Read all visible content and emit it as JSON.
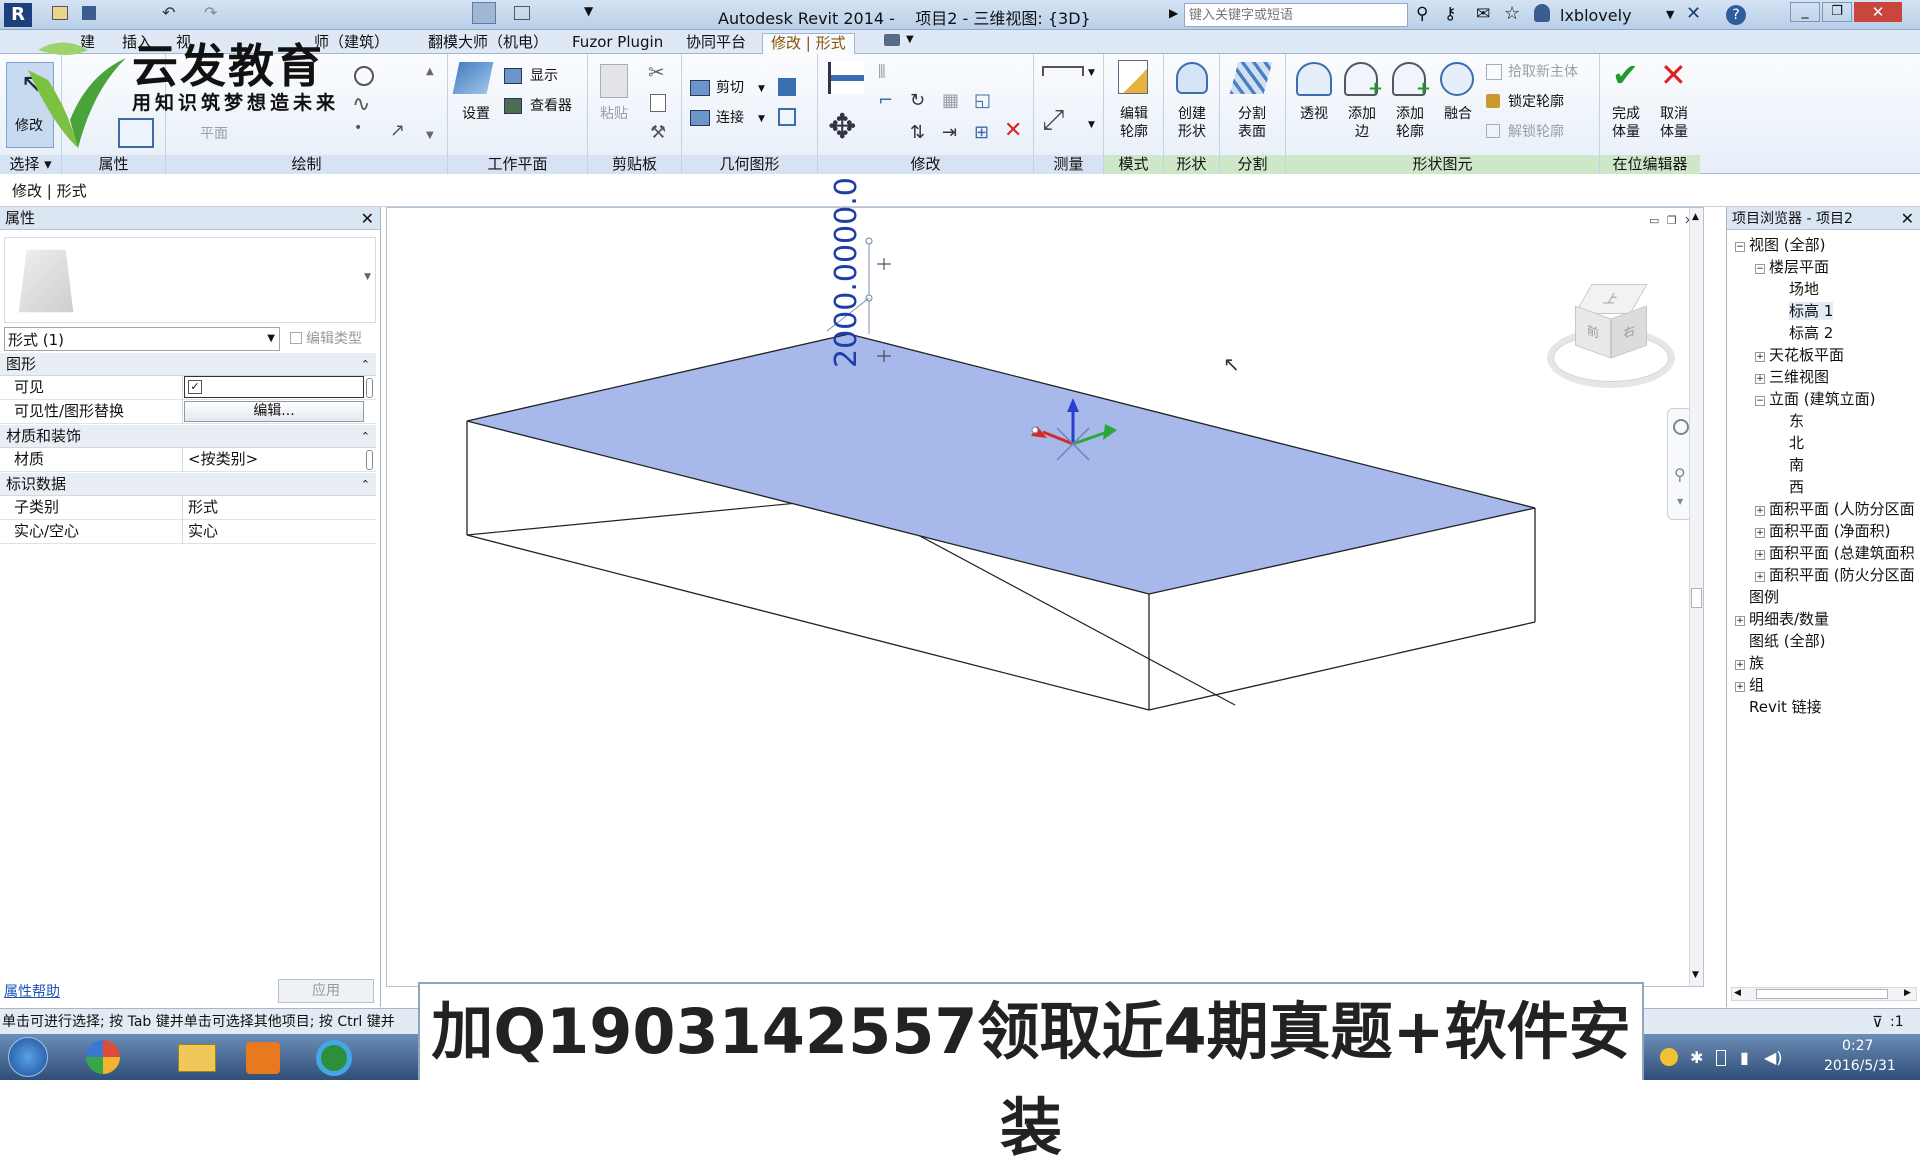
{
  "titlebar": {
    "title": "Autodesk Revit 2014 -    项目2 - 三维视图: {3D}",
    "search_placeholder": "键入关键字或短语",
    "user": "lxblovely"
  },
  "logo": {
    "brand": "云发教育",
    "slogan": "用知识筑梦想造未来"
  },
  "tabs": [
    {
      "label": "建"
    },
    {
      "label": "插入"
    },
    {
      "label": "视"
    },
    {
      "label": "师（建筑）"
    },
    {
      "label": "翻模大师（机电）"
    },
    {
      "label": "Fuzor Plugin"
    },
    {
      "label": "协同平台"
    },
    {
      "label": "修改 | 形式"
    }
  ],
  "ribbon": {
    "groups": {
      "select": "选择 ▾",
      "properties": "属性",
      "draw": "绘制",
      "workplane": "工作平面",
      "clipboard": "剪贴板",
      "geometry": "几何图形",
      "modify": "修改",
      "measure": "测量",
      "mode": "模式",
      "shape": "形状",
      "divide": "分割",
      "form_element": "形状图元",
      "inplace_editor": "在位编辑器"
    },
    "buttons": {
      "modify": "修改",
      "plane": "平面",
      "set": "设置",
      "show": "显示",
      "viewer": "查看器",
      "paste": "粘贴",
      "cut": "剪切",
      "join": "连接",
      "edit_profile_1": "编辑",
      "edit_profile_2": "轮廓",
      "create_form_1": "创建",
      "create_form_2": "形状",
      "divide_surface_1": "分割",
      "divide_surface_2": "表面",
      "xray": "透视",
      "add_edge_1": "添加",
      "add_edge_2": "边",
      "add_profile_1": "添加",
      "add_profile_2": "轮廓",
      "blend": "融合",
      "pick_host": "拾取新主体",
      "lock_profile": "锁定轮廓",
      "unlock_profile": "解锁轮廓",
      "finish_1": "完成",
      "finish_2": "体量",
      "cancel_1": "取消",
      "cancel_2": "体量"
    }
  },
  "context_bar": "修改 | 形式",
  "properties": {
    "title": "属性",
    "type_selector": "形式 (1)",
    "edit_type": "编辑类型",
    "sections": {
      "graphics": "图形",
      "materials": "材质和装饰",
      "identity": "标识数据"
    },
    "rows": {
      "visible_label": "可见",
      "visibility_override_label": "可见性/图形替换",
      "visibility_override_button": "编辑...",
      "material_label": "材质",
      "material_value": "<按类别>",
      "subcategory_label": "子类别",
      "subcategory_value": "形式",
      "solid_void_label": "实心/空心",
      "solid_void_value": "实心"
    },
    "help_link": "属性帮助",
    "apply_button": "应用"
  },
  "viewport": {
    "dimension_label": "2000.0000.0",
    "viewcube_labels": {
      "top": "上",
      "front": "前",
      "right": "右"
    }
  },
  "project_browser": {
    "title": "项目浏览器 - 项目2",
    "items": [
      {
        "label": "视图 (全部)",
        "level": 0,
        "toggle": "−"
      },
      {
        "label": "楼层平面",
        "level": 1,
        "toggle": "−"
      },
      {
        "label": "场地",
        "level": 2,
        "toggle": ""
      },
      {
        "label": "标高 1",
        "level": 2,
        "toggle": ""
      },
      {
        "label": "标高 2",
        "level": 2,
        "toggle": ""
      },
      {
        "label": "天花板平面",
        "level": 1,
        "toggle": "+"
      },
      {
        "label": "三维视图",
        "level": 1,
        "toggle": "+"
      },
      {
        "label": "立面 (建筑立面)",
        "level": 1,
        "toggle": "−"
      },
      {
        "label": "东",
        "level": 2,
        "toggle": ""
      },
      {
        "label": "北",
        "level": 2,
        "toggle": ""
      },
      {
        "label": "南",
        "level": 2,
        "toggle": ""
      },
      {
        "label": "西",
        "level": 2,
        "toggle": ""
      },
      {
        "label": "面积平面 (人防分区面",
        "level": 1,
        "toggle": "+"
      },
      {
        "label": "面积平面 (净面积)",
        "level": 1,
        "toggle": "+"
      },
      {
        "label": "面积平面 (总建筑面积",
        "level": 1,
        "toggle": "+"
      },
      {
        "label": "面积平面 (防火分区面",
        "level": 1,
        "toggle": "+"
      },
      {
        "label": "图例",
        "level": 0,
        "toggle": ""
      },
      {
        "label": "明细表/数量",
        "level": 0,
        "toggle": "+"
      },
      {
        "label": "图纸 (全部)",
        "level": 0,
        "toggle": ""
      },
      {
        "label": "族",
        "level": 0,
        "toggle": "+"
      },
      {
        "label": "组",
        "level": 0,
        "toggle": "+"
      },
      {
        "label": "Revit 链接",
        "level": 0,
        "toggle": ""
      }
    ]
  },
  "status": {
    "message": "单击可进行选择; 按 Tab 键并单击可选择其他项目; 按 Ctrl 键并",
    "filter_count": ":1"
  },
  "taskbar": {
    "time": "0:27",
    "date": "2016/5/31"
  },
  "banner": "加Q1903142557领取近4期真题+软件安装"
}
